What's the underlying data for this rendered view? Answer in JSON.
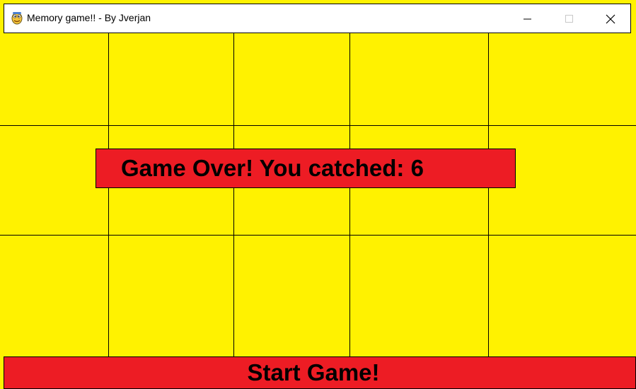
{
  "window": {
    "title": "Memory game!! - By Jverjan",
    "app_icon": "pygame-snake-icon",
    "controls": {
      "minimize_icon": "minimize-icon",
      "maximize_icon": "maximize-icon",
      "close_icon": "close-icon"
    }
  },
  "board": {
    "background_color": "#fff200",
    "rows": 3,
    "columns": 5,
    "grid_color": "#000000"
  },
  "game_over": {
    "message": "Game Over! You catched: 6",
    "background_color": "#ed1c24"
  },
  "start_button": {
    "label": "Start Game!",
    "background_color": "#ed1c24"
  }
}
